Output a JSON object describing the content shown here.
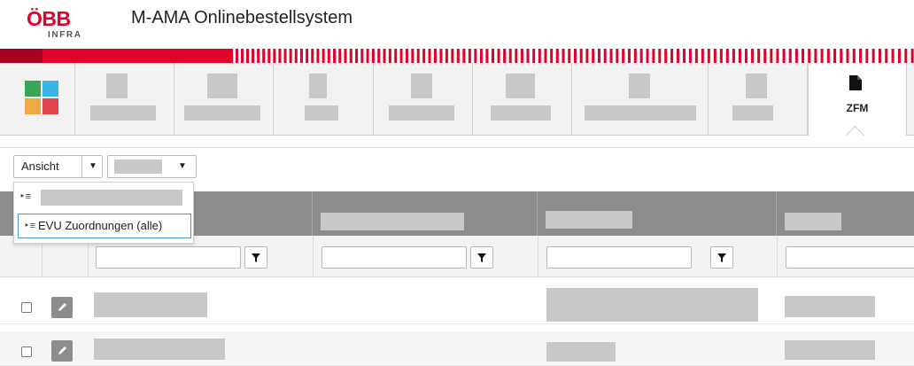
{
  "header": {
    "logo_main": "ÖBB",
    "logo_sub": "INFRA",
    "title": "M-AMA Onlinebestellsystem"
  },
  "nav": {
    "active_tab_label": "ZFM",
    "active_tab_icon": "document-icon"
  },
  "toolbar": {
    "view_select_label": "Ansicht",
    "dropdown_arrow": "▼"
  },
  "dropdown": {
    "items": [
      {
        "label": ""
      },
      {
        "label": "EVU Zuordnungen (alle)"
      }
    ],
    "item_glyph": "‣≡"
  },
  "colors": {
    "brand_red": "#e2002a",
    "accent_blue": "#4a90d9",
    "header_gray": "#8c8c8c",
    "tile_green": "#3aa655",
    "tile_cyan": "#3ab6e6",
    "tile_orange": "#f0a844",
    "tile_red": "#e0474c"
  }
}
